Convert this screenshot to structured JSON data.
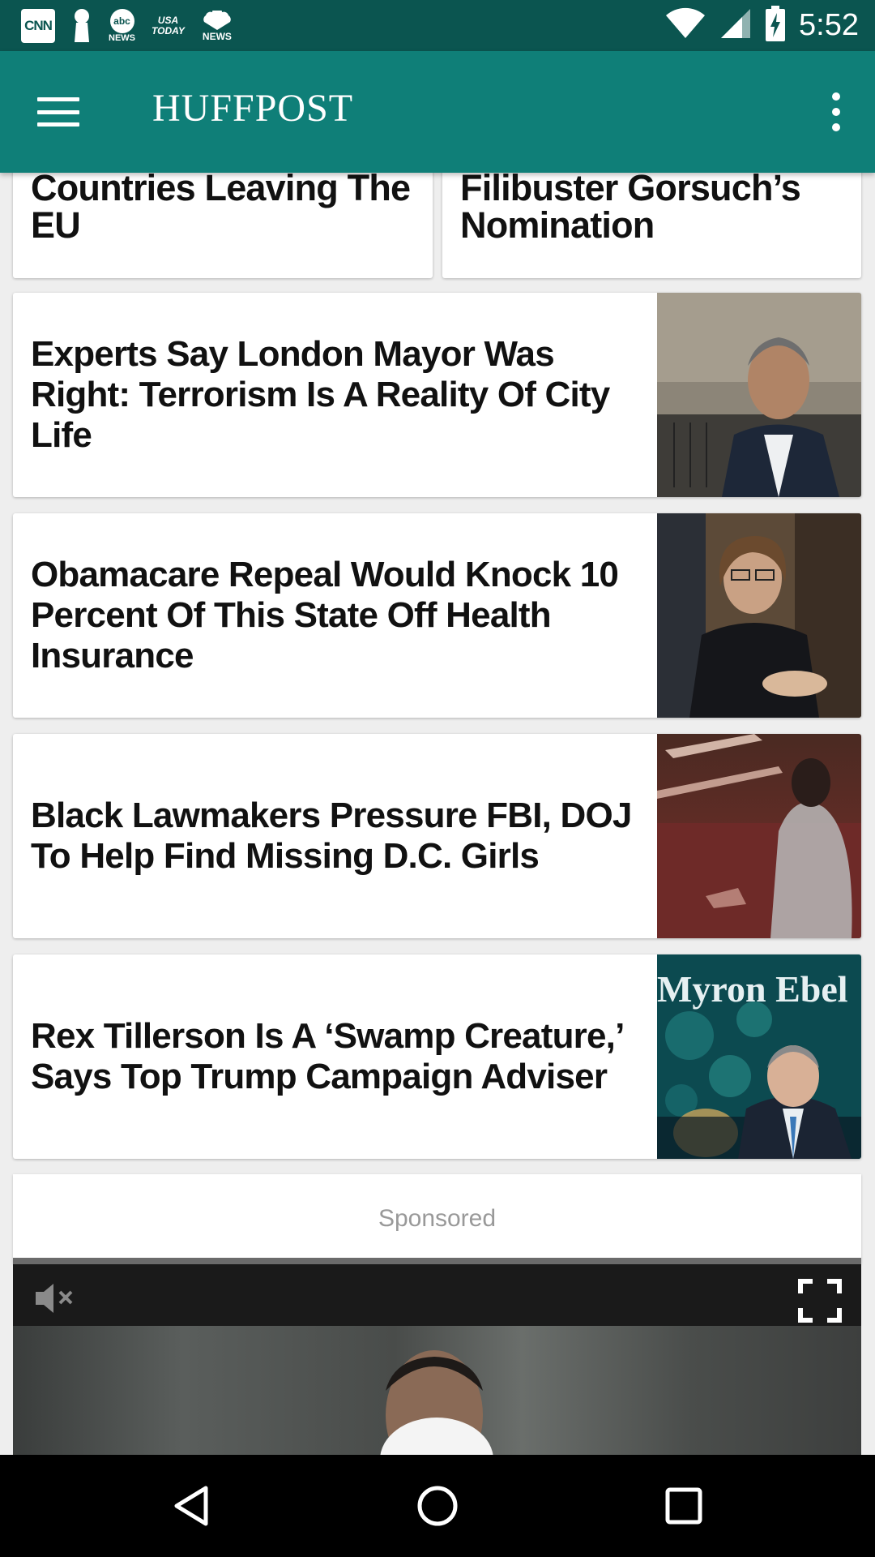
{
  "status_bar": {
    "notifications": [
      {
        "icon": "cnn-icon",
        "text": "CNN"
      },
      {
        "icon": "keyhole-icon",
        "text": ""
      },
      {
        "icon": "abc-news-icon",
        "text": "abc",
        "sub": "NEWS"
      },
      {
        "icon": "usa-today-icon",
        "text": "USA",
        "sub": "TODAY"
      },
      {
        "icon": "nbc-news-icon",
        "text": "NEWS"
      }
    ],
    "time": "5:52"
  },
  "app_bar": {
    "title": "HUFFPOST",
    "menu_icon": "hamburger-icon",
    "overflow_icon": "more-vert-icon"
  },
  "articles": {
    "top_left": {
      "headline": "Countries Leaving The EU"
    },
    "top_right": {
      "headline": "Filibuster Gorsuch’s Nomination"
    },
    "list": [
      {
        "headline": "Experts Say London Mayor Was Right: Terrorism Is A Reality Of City Life"
      },
      {
        "headline": "Obamacare Repeal Would Knock 10 Percent Of This State Off Health Insurance"
      },
      {
        "headline": "Black Lawmakers Pressure FBI, DOJ To Help Find Missing D.C. Girls"
      },
      {
        "headline": "Rex Tillerson Is A ‘Swamp Creature,’ Says Top Trump Campaign Adviser",
        "image_text": "Myron Ebel"
      }
    ]
  },
  "sponsored": {
    "label": "Sponsored"
  },
  "colors": {
    "status_bar": "#0b5550",
    "app_bar": "#0f7f78",
    "background": "#eeeeee"
  }
}
